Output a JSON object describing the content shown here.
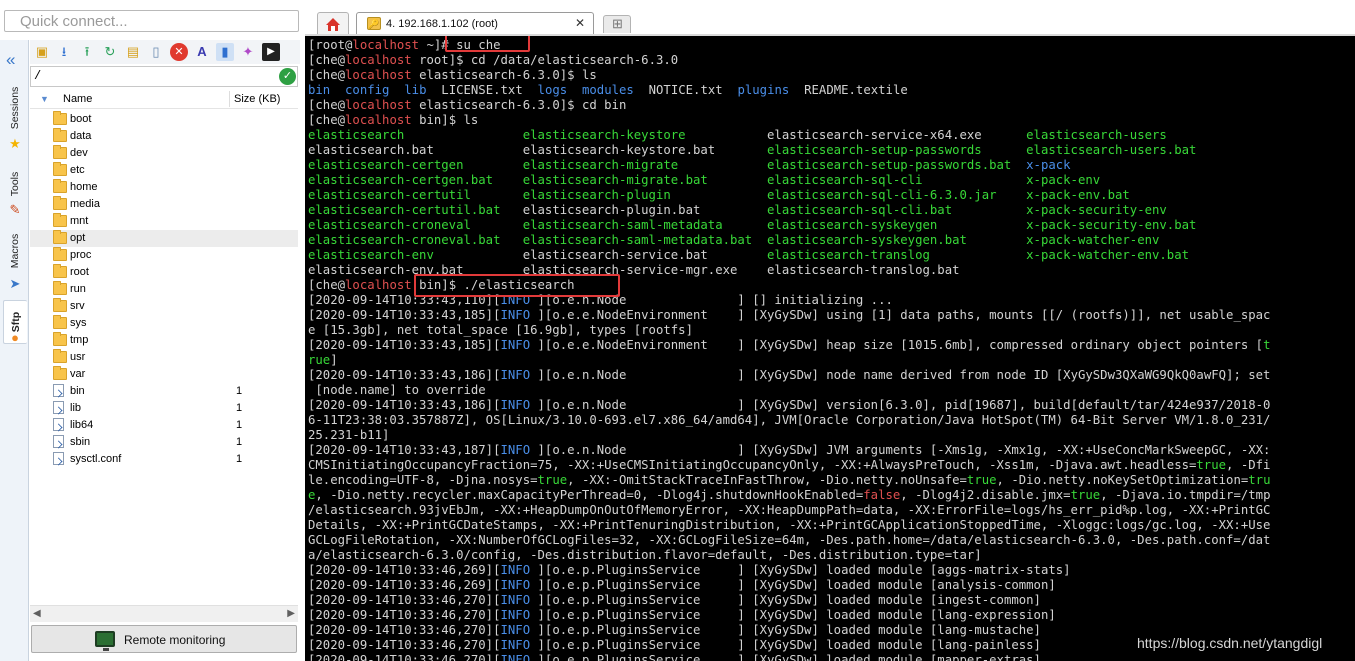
{
  "quick_connect": {
    "placeholder": "Quick connect..."
  },
  "side_tabs": [
    "Sessions",
    "Tools",
    "Macros",
    "Sftp"
  ],
  "sftp": {
    "path": "/",
    "columns": [
      "Name",
      "Size (KB)"
    ],
    "files": [
      {
        "name": "boot",
        "size": "",
        "type": "folder"
      },
      {
        "name": "data",
        "size": "",
        "type": "folder"
      },
      {
        "name": "dev",
        "size": "",
        "type": "folder"
      },
      {
        "name": "etc",
        "size": "",
        "type": "folder"
      },
      {
        "name": "home",
        "size": "",
        "type": "folder"
      },
      {
        "name": "media",
        "size": "",
        "type": "folder"
      },
      {
        "name": "mnt",
        "size": "",
        "type": "folder"
      },
      {
        "name": "opt",
        "size": "",
        "type": "folder"
      },
      {
        "name": "proc",
        "size": "",
        "type": "folder"
      },
      {
        "name": "root",
        "size": "",
        "type": "folder"
      },
      {
        "name": "run",
        "size": "",
        "type": "folder"
      },
      {
        "name": "srv",
        "size": "",
        "type": "folder"
      },
      {
        "name": "sys",
        "size": "",
        "type": "folder"
      },
      {
        "name": "tmp",
        "size": "",
        "type": "folder"
      },
      {
        "name": "usr",
        "size": "",
        "type": "folder"
      },
      {
        "name": "var",
        "size": "",
        "type": "folder"
      },
      {
        "name": "bin",
        "size": "1",
        "type": "link"
      },
      {
        "name": "lib",
        "size": "1",
        "type": "link"
      },
      {
        "name": "lib64",
        "size": "1",
        "type": "link"
      },
      {
        "name": "sbin",
        "size": "1",
        "type": "link"
      },
      {
        "name": "sysctl.conf",
        "size": "1",
        "type": "link"
      }
    ],
    "selected_index": 7,
    "remote_monitoring_label": "Remote monitoring"
  },
  "tabs": [
    {
      "label": "4. 192.168.1.102 (root)",
      "active": true
    }
  ],
  "terminal": {
    "lines": [
      [
        [
          "w",
          "[root@"
        ],
        [
          "r",
          "localhost"
        ],
        [
          "w",
          " ~]"
        ],
        [
          "w",
          "# su che"
        ]
      ],
      [
        [
          "w",
          "[che@"
        ],
        [
          "r",
          "localhost"
        ],
        [
          "w",
          " root]$ cd /data/elasticsearch-6.3.0"
        ]
      ],
      [
        [
          "w",
          "[che@"
        ],
        [
          "r",
          "localhost"
        ],
        [
          "w",
          " elasticsearch-6.3.0]$ ls"
        ]
      ],
      [
        [
          "b",
          "bin"
        ],
        [
          "w",
          "  "
        ],
        [
          "b",
          "config"
        ],
        [
          "w",
          "  "
        ],
        [
          "b",
          "lib"
        ],
        [
          "w",
          "  LICENSE.txt  "
        ],
        [
          "b",
          "logs"
        ],
        [
          "w",
          "  "
        ],
        [
          "b",
          "modules"
        ],
        [
          "w",
          "  NOTICE.txt  "
        ],
        [
          "b",
          "plugins"
        ],
        [
          "w",
          "  README.textile"
        ]
      ],
      [
        [
          "w",
          "[che@"
        ],
        [
          "r",
          "localhost"
        ],
        [
          "w",
          " elasticsearch-6.3.0]$ cd bin"
        ]
      ],
      [
        [
          "w",
          "[che@"
        ],
        [
          "r",
          "localhost"
        ],
        [
          "w",
          " bin]$ ls"
        ]
      ],
      [
        [
          "g",
          "elasticsearch                "
        ],
        [
          "g",
          "elasticsearch-keystore           "
        ],
        [
          "w",
          "elasticsearch-service-x64.exe      "
        ],
        [
          "g",
          "elasticsearch-users"
        ]
      ],
      [
        [
          "w",
          "elasticsearch.bat            "
        ],
        [
          "w",
          "elasticsearch-keystore.bat       "
        ],
        [
          "g",
          "elasticsearch-setup-passwords      "
        ],
        [
          "g",
          "elasticsearch-users.bat"
        ]
      ],
      [
        [
          "g",
          "elasticsearch-certgen        "
        ],
        [
          "g",
          "elasticsearch-migrate            "
        ],
        [
          "g",
          "elasticsearch-setup-passwords.bat  "
        ],
        [
          "b",
          "x-pack"
        ]
      ],
      [
        [
          "g",
          "elasticsearch-certgen.bat    "
        ],
        [
          "g",
          "elasticsearch-migrate.bat        "
        ],
        [
          "g",
          "elasticsearch-sql-cli              "
        ],
        [
          "g",
          "x-pack-env"
        ]
      ],
      [
        [
          "g",
          "elasticsearch-certutil       "
        ],
        [
          "g",
          "elasticsearch-plugin             "
        ],
        [
          "g",
          "elasticsearch-sql-cli-6.3.0.jar    "
        ],
        [
          "g",
          "x-pack-env.bat"
        ]
      ],
      [
        [
          "g",
          "elasticsearch-certutil.bat   "
        ],
        [
          "w",
          "elasticsearch-plugin.bat         "
        ],
        [
          "g",
          "elasticsearch-sql-cli.bat          "
        ],
        [
          "g",
          "x-pack-security-env"
        ]
      ],
      [
        [
          "g",
          "elasticsearch-croneval       "
        ],
        [
          "g",
          "elasticsearch-saml-metadata      "
        ],
        [
          "g",
          "elasticsearch-syskeygen           "
        ],
        [
          "g",
          " x-pack-security-env.bat"
        ]
      ],
      [
        [
          "g",
          "elasticsearch-croneval.bat   "
        ],
        [
          "g",
          "elasticsearch-saml-metadata.bat  "
        ],
        [
          "g",
          "elasticsearch-syskeygen.bat        "
        ],
        [
          "g",
          "x-pack-watcher-env"
        ]
      ],
      [
        [
          "g",
          "elasticsearch-env            "
        ],
        [
          "w",
          "elasticsearch-service.bat        "
        ],
        [
          "g",
          "elasticsearch-translog             "
        ],
        [
          "g",
          "x-pack-watcher-env.bat"
        ]
      ],
      [
        [
          "w",
          "elasticsearch-env.bat        "
        ],
        [
          "w",
          "elasticsearch-service-mgr.exe    "
        ],
        [
          "w",
          "elasticsearch-translog.bat"
        ]
      ],
      [
        [
          "w",
          "[che@"
        ],
        [
          "r",
          "localhost"
        ],
        [
          "w",
          " bin]$ ./elasticsearch"
        ]
      ],
      [
        [
          "w",
          "[2020-09-14T10:33:43,110]["
        ],
        [
          "b",
          "INFO"
        ],
        [
          "w",
          " ][o.e.n.Node               ] [] initializing ..."
        ]
      ],
      [
        [
          "w",
          "[2020-09-14T10:33:43,185]["
        ],
        [
          "b",
          "INFO"
        ],
        [
          "w",
          " ][o.e.e.NodeEnvironment    ] [XyGySDw] using [1] data paths, mounts [[/ (rootfs)]], net usable_spac"
        ]
      ],
      [
        [
          "w",
          "e [15.3gb], net total_space [16.9gb], types [rootfs]"
        ]
      ],
      [
        [
          "w",
          "[2020-09-14T10:33:43,185]["
        ],
        [
          "b",
          "INFO"
        ],
        [
          "w",
          " ][o.e.e.NodeEnvironment    ] [XyGySDw] heap size [1015.6mb], compressed ordinary object pointers ["
        ],
        [
          "g",
          "t"
        ]
      ],
      [
        [
          "g",
          "rue"
        ],
        [
          "w",
          "]"
        ]
      ],
      [
        [
          "w",
          "[2020-09-14T10:33:43,186]["
        ],
        [
          "b",
          "INFO"
        ],
        [
          "w",
          " ][o.e.n.Node               ] [XyGySDw] node name derived from node ID [XyGySDw3QXaWG9QkQ0awFQ]; set"
        ]
      ],
      [
        [
          "w",
          " [node.name] to override"
        ]
      ],
      [
        [
          "w",
          "[2020-09-14T10:33:43,186]["
        ],
        [
          "b",
          "INFO"
        ],
        [
          "w",
          " ][o.e.n.Node               ] [XyGySDw] version[6.3.0], pid[19687], build[default/tar/424e937/2018-0"
        ]
      ],
      [
        [
          "w",
          "6-11T23:38:03.357887Z], OS[Linux/3.10.0-693.el7.x86_64/amd64], JVM[Oracle Corporation/Java HotSpot(TM) 64-Bit Server VM/1.8.0_231/"
        ]
      ],
      [
        [
          "w",
          "25.231-b11]"
        ]
      ],
      [
        [
          "w",
          "[2020-09-14T10:33:43,187]["
        ],
        [
          "b",
          "INFO"
        ],
        [
          "w",
          " ][o.e.n.Node               ] [XyGySDw] JVM arguments [-Xms1g, -Xmx1g, -XX:+UseConcMarkSweepGC, -XX:"
        ]
      ],
      [
        [
          "w",
          "CMSInitiatingOccupancyFraction=75, -XX:+UseCMSInitiatingOccupancyOnly, -XX:+AlwaysPreTouch, -Xss1m, -Djava.awt.headless="
        ],
        [
          "g",
          "true"
        ],
        [
          "w",
          ", -Dfi"
        ]
      ],
      [
        [
          "w",
          "le.encoding=UTF-8, -Djna.nosys="
        ],
        [
          "g",
          "true"
        ],
        [
          "w",
          ", -XX:-OmitStackTraceInFastThrow, -Dio.netty.noUnsafe="
        ],
        [
          "g",
          "true"
        ],
        [
          "w",
          ", -Dio.netty.noKeySetOptimization="
        ],
        [
          "g",
          "tru"
        ]
      ],
      [
        [
          "g",
          "e"
        ],
        [
          "w",
          ", -Dio.netty.recycler.maxCapacityPerThread=0, -Dlog4j.shutdownHookEnabled="
        ],
        [
          "r",
          "false"
        ],
        [
          "w",
          ", -Dlog4j2.disable.jmx="
        ],
        [
          "g",
          "true"
        ],
        [
          "w",
          ", -Djava.io.tmpdir=/tmp"
        ]
      ],
      [
        [
          "w",
          "/elasticsearch.93jvEbJm, -XX:+HeapDumpOnOutOfMemoryError, -XX:HeapDumpPath=data, -XX:ErrorFile=logs/hs_err_pid%p.log, -XX:+PrintGC"
        ]
      ],
      [
        [
          "w",
          "Details, -XX:+PrintGCDateStamps, -XX:+PrintTenuringDistribution, -XX:+PrintGCApplicationStoppedTime, -Xloggc:logs/gc.log, -XX:+Use"
        ]
      ],
      [
        [
          "w",
          "GCLogFileRotation, -XX:NumberOfGCLogFiles=32, -XX:GCLogFileSize=64m, -Des.path.home=/data/elasticsearch-6.3.0, -Des.path.conf=/dat"
        ]
      ],
      [
        [
          "w",
          "a/elasticsearch-6.3.0/config, -Des.distribution.flavor=default, -Des.distribution.type=tar]"
        ]
      ],
      [
        [
          "w",
          "[2020-09-14T10:33:46,269]["
        ],
        [
          "b",
          "INFO"
        ],
        [
          "w",
          " ][o.e.p.PluginsService     ] [XyGySDw] loaded module [aggs-matrix-stats]"
        ]
      ],
      [
        [
          "w",
          "[2020-09-14T10:33:46,269]["
        ],
        [
          "b",
          "INFO"
        ],
        [
          "w",
          " ][o.e.p.PluginsService     ] [XyGySDw] loaded module [analysis-common]"
        ]
      ],
      [
        [
          "w",
          "[2020-09-14T10:33:46,270]["
        ],
        [
          "b",
          "INFO"
        ],
        [
          "w",
          " ][o.e.p.PluginsService     ] [XyGySDw] loaded module [ingest-common]"
        ]
      ],
      [
        [
          "w",
          "[2020-09-14T10:33:46,270]["
        ],
        [
          "b",
          "INFO"
        ],
        [
          "w",
          " ][o.e.p.PluginsService     ] [XyGySDw] loaded module [lang-expression]"
        ]
      ],
      [
        [
          "w",
          "[2020-09-14T10:33:46,270]["
        ],
        [
          "b",
          "INFO"
        ],
        [
          "w",
          " ][o.e.p.PluginsService     ] [XyGySDw] loaded module [lang-mustache]"
        ]
      ],
      [
        [
          "w",
          "[2020-09-14T10:33:46,270]["
        ],
        [
          "b",
          "INFO"
        ],
        [
          "w",
          " ][o.e.p.PluginsService     ] [XyGySDw] loaded module [lang-painless]"
        ]
      ],
      [
        [
          "w",
          "[2020-09-14T10:33:46,270]["
        ],
        [
          "b",
          "INFO"
        ],
        [
          "w",
          " ][o.e.p.PluginsService     ] [XyGySDw] loaded module [mapper-extras]"
        ]
      ]
    ]
  },
  "watermark": "https://blog.csdn.net/ytangdigl",
  "colors": {
    "accent": "#e23a3a",
    "terminal_bg": "#000000",
    "green": "#38d838",
    "blue": "#4a8ee8",
    "red": "#e05050"
  }
}
